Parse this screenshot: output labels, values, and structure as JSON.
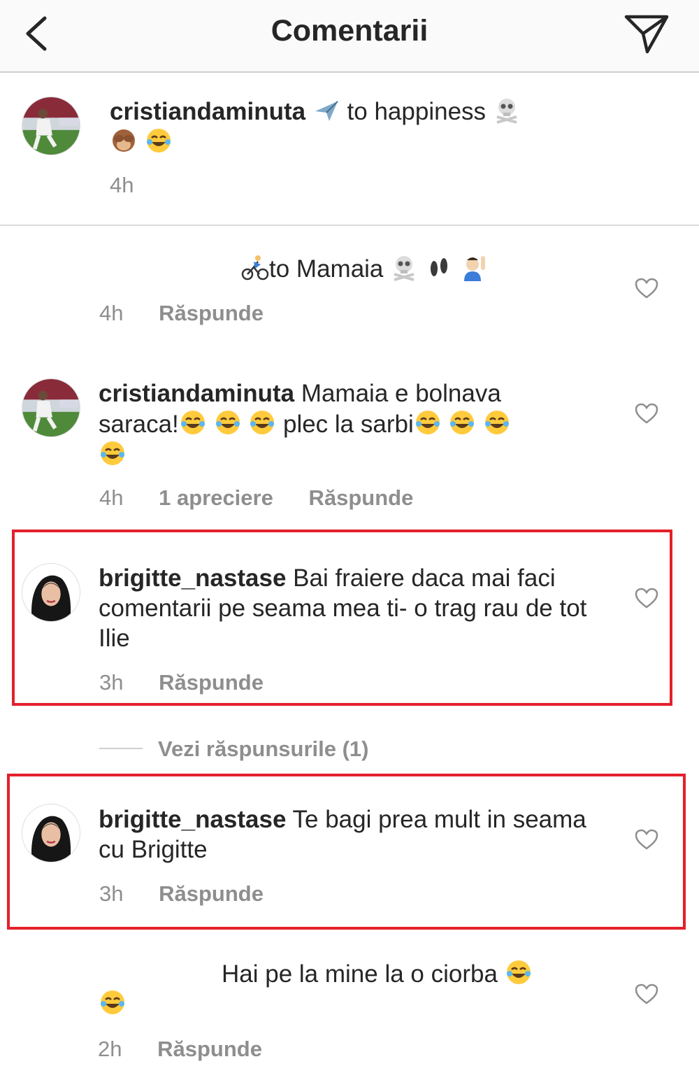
{
  "header": {
    "title": "Comentarii"
  },
  "caption": {
    "username": "cristiandaminuta",
    "text_1": "to happiness",
    "time": "4h"
  },
  "comments": [
    {
      "username": "",
      "text": "to Mamaia",
      "time": "4h",
      "reply_label": "Răspunde"
    },
    {
      "username": "cristiandaminuta",
      "text_line1": "Mamaia e bolnava",
      "text_line2a": "saraca!",
      "text_line2b": " plec la sarbi",
      "time": "4h",
      "likes": "1 apreciere",
      "reply_label": "Răspunde"
    },
    {
      "username": "brigitte_nastase",
      "text": "Bai fraiere daca mai faci comentarii pe seama mea ti- o trag rau de tot Ilie",
      "time": "3h",
      "reply_label": "Răspunde"
    },
    {
      "username": "brigitte_nastase",
      "text": "Te bagi prea mult in seama cu Brigitte",
      "time": "3h",
      "reply_label": "Răspunde"
    },
    {
      "username": "",
      "text": "Hai pe la mine la o ciorba",
      "time": "2h",
      "reply_label": "Răspunde"
    }
  ],
  "view_replies": "Vezi răspunsurile (1)",
  "colors": {
    "highlight": "#e3202b",
    "meta": "#8e8e8e",
    "text": "#262626"
  }
}
